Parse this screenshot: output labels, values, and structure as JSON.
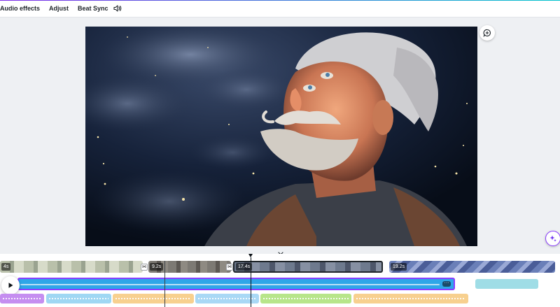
{
  "toolbar": {
    "audio_effects": "Audio effects",
    "adjust": "Adjust",
    "beat_sync": "Beat Sync",
    "volume_icon": "speaker-icon"
  },
  "canvas": {
    "image_description_icon": "old-man-starry-sky-artwork",
    "comment_icon": "comment-add-icon",
    "magic_icon": "magic-sparkle-icon"
  },
  "timeline": {
    "clips": [
      {
        "label": "4s"
      },
      {
        "label": "9.2s"
      },
      {
        "label": "17.4s"
      },
      {
        "label": "19.2s"
      }
    ],
    "play_icon": "play-icon",
    "more_label": "···",
    "transition_icon": "transition-icon"
  },
  "colors": {
    "brand_gradient_start": "#7d2ae8",
    "brand_gradient_end": "#00c4cc",
    "selected_audio": "#2fa6e8",
    "selection_outline": "#8b3dff"
  }
}
